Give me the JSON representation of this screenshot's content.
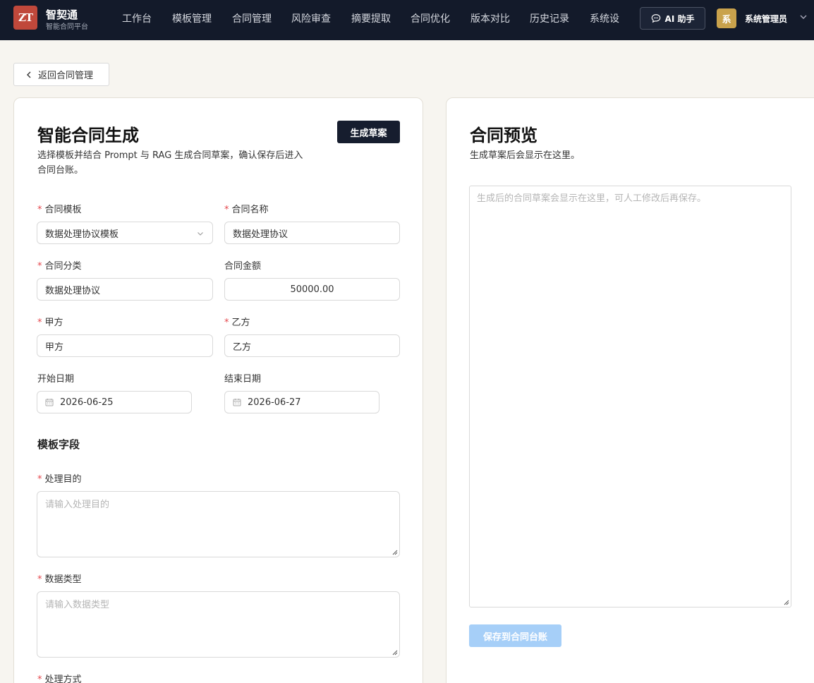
{
  "brand": {
    "logo": "ZT",
    "name": "智契通",
    "subtitle": "智能合同平台"
  },
  "nav": [
    "工作台",
    "模板管理",
    "合同管理",
    "风险审查",
    "摘要提取",
    "合同优化",
    "版本对比",
    "历史记录",
    "系统设"
  ],
  "ai_button": {
    "label": "AI 助手",
    "icon": "chat-bubble-icon"
  },
  "user": {
    "avatar": "系",
    "name": "系统管理员"
  },
  "back_button": "返回合同管理",
  "form": {
    "title": "智能合同生成",
    "description_line1": "选择模板并结合 Prompt 与 RAG 生成合同草案，确认保存后进入",
    "description_line2": "合同台账。",
    "generate_button": "生成草案",
    "template": {
      "label": "合同模板",
      "value": "数据处理协议模板"
    },
    "name": {
      "label": "合同名称",
      "value": "数据处理协议"
    },
    "category": {
      "label": "合同分类",
      "value": "数据处理协议"
    },
    "amount": {
      "label": "合同金额",
      "value": "50000.00"
    },
    "party_a": {
      "label": "甲方",
      "placeholder": "甲方"
    },
    "party_b": {
      "label": "乙方",
      "placeholder": "乙方"
    },
    "start_date": {
      "label": "开始日期",
      "value": "2026-06-25"
    },
    "end_date": {
      "label": "结束日期",
      "value": "2026-06-27"
    },
    "template_fields_title": "模板字段",
    "purpose": {
      "label": "处理目的",
      "placeholder": "请输入处理目的"
    },
    "data_type": {
      "label": "数据类型",
      "placeholder": "请输入数据类型"
    },
    "method": {
      "label": "处理方式"
    }
  },
  "preview": {
    "title": "合同预览",
    "description": "生成草案后会显示在这里。",
    "placeholder": "生成后的合同草案会显示在这里，可人工修改后再保存。",
    "save_button": "保存到合同台账"
  },
  "colors": {
    "nav_bg": "#131a2a",
    "logo_bg": "#c0483b",
    "avatar_bg": "#c9a24c",
    "primary_dark": "#161d2e",
    "save_disabled": "#a6cff8",
    "required": "#e5484d"
  }
}
